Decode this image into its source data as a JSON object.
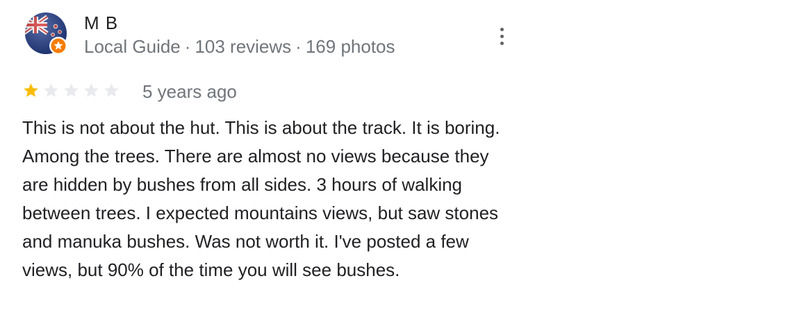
{
  "reviewer": {
    "name": "M B",
    "avatar_icon": "new-zealand-flag-icon",
    "badge_icon": "local-guide-star-icon",
    "badge_color": "#f57c00",
    "meta": {
      "level": "Local Guide",
      "separator": "·",
      "reviews": "103 reviews",
      "photos": "169 photos"
    }
  },
  "menu": {
    "icon": "more-vert-icon"
  },
  "review": {
    "rating": 1,
    "max_rating": 5,
    "star_filled_color": "#fbbc04",
    "star_empty_color": "#e8eaed",
    "time_ago": "5 years ago",
    "text": "This is not about the hut. This is about the track. It is boring. Among the trees. There are almost no views because they are hidden by bushes from all sides. 3 hours of walking between trees. I expected mountains views, but saw stones and manuka bushes. Was not worth it. I've posted a few views, but 90% of the time you will see bushes."
  }
}
